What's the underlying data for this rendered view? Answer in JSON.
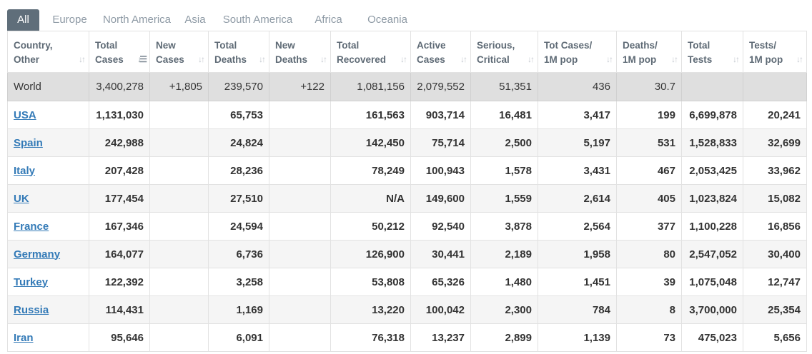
{
  "tabs": [
    "All",
    "Europe",
    "North America",
    "Asia",
    "South America",
    "Africa",
    "Oceania"
  ],
  "active_tab": "All",
  "columns": [
    {
      "line1": "Country,",
      "line2": "Other",
      "sort": "none"
    },
    {
      "line1": "Total",
      "line2": "Cases",
      "sort": "desc"
    },
    {
      "line1": "New",
      "line2": "Cases",
      "sort": "none"
    },
    {
      "line1": "Total",
      "line2": "Deaths",
      "sort": "none"
    },
    {
      "line1": "New",
      "line2": "Deaths",
      "sort": "none"
    },
    {
      "line1": "Total",
      "line2": "Recovered",
      "sort": "none"
    },
    {
      "line1": "Active",
      "line2": "Cases",
      "sort": "none"
    },
    {
      "line1": "Serious,",
      "line2": "Critical",
      "sort": "none"
    },
    {
      "line1": "Tot Cases/",
      "line2": "1M pop",
      "sort": "none"
    },
    {
      "line1": "Deaths/",
      "line2": "1M pop",
      "sort": "none"
    },
    {
      "line1": "Total",
      "line2": "Tests",
      "sort": "none"
    },
    {
      "line1": "Tests/",
      "line2": "1M pop",
      "sort": "none"
    }
  ],
  "world_row": [
    "World",
    "3,400,278",
    "+1,805",
    "239,570",
    "+122",
    "1,081,156",
    "2,079,552",
    "51,351",
    "436",
    "30.7",
    "",
    ""
  ],
  "rows": [
    [
      "USA",
      "1,131,030",
      "",
      "65,753",
      "",
      "161,563",
      "903,714",
      "16,481",
      "3,417",
      "199",
      "6,699,878",
      "20,241"
    ],
    [
      "Spain",
      "242,988",
      "",
      "24,824",
      "",
      "142,450",
      "75,714",
      "2,500",
      "5,197",
      "531",
      "1,528,833",
      "32,699"
    ],
    [
      "Italy",
      "207,428",
      "",
      "28,236",
      "",
      "78,249",
      "100,943",
      "1,578",
      "3,431",
      "467",
      "2,053,425",
      "33,962"
    ],
    [
      "UK",
      "177,454",
      "",
      "27,510",
      "",
      "N/A",
      "149,600",
      "1,559",
      "2,614",
      "405",
      "1,023,824",
      "15,082"
    ],
    [
      "France",
      "167,346",
      "",
      "24,594",
      "",
      "50,212",
      "92,540",
      "3,878",
      "2,564",
      "377",
      "1,100,228",
      "16,856"
    ],
    [
      "Germany",
      "164,077",
      "",
      "6,736",
      "",
      "126,900",
      "30,441",
      "2,189",
      "1,958",
      "80",
      "2,547,052",
      "30,400"
    ],
    [
      "Turkey",
      "122,392",
      "",
      "3,258",
      "",
      "53,808",
      "65,326",
      "1,480",
      "1,451",
      "39",
      "1,075,048",
      "12,747"
    ],
    [
      "Russia",
      "114,431",
      "",
      "1,169",
      "",
      "13,220",
      "100,042",
      "2,300",
      "784",
      "8",
      "3,700,000",
      "25,354"
    ],
    [
      "Iran",
      "95,646",
      "",
      "6,091",
      "",
      "76,318",
      "13,237",
      "2,899",
      "1,139",
      "73",
      "475,023",
      "5,656"
    ]
  ],
  "colors": {
    "active_tab_bg": "#5f6e7a",
    "tab_text": "#8e9aa5",
    "header_text": "#5e6a75",
    "world_row_bg": "#dfdfdf",
    "link": "#337ab7",
    "striped_row_bg": "#f5f5f5"
  },
  "icons": {
    "sort_default": "sort-arrows-icon",
    "sort_desc": "sort-desc-icon"
  }
}
